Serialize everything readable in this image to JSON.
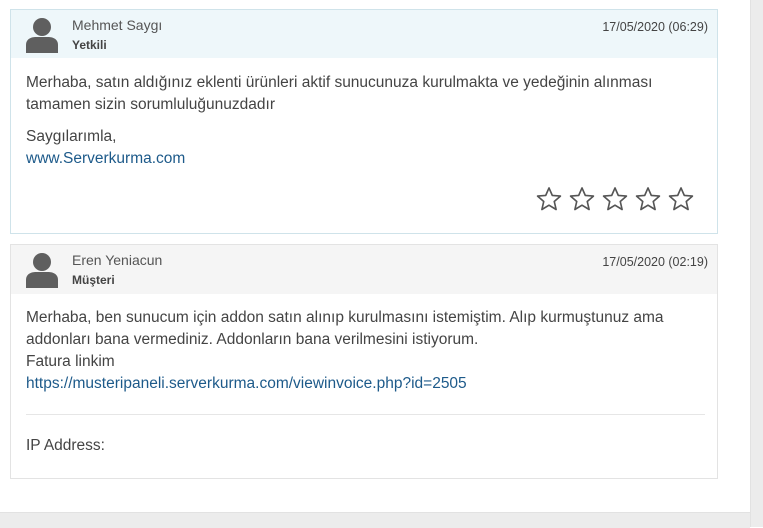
{
  "replies": [
    {
      "author": "Mehmet Saygı",
      "role": "Yetkili",
      "date": "17/05/2020 (06:29)",
      "message_line1": "Merhaba, satın aldığınız eklenti ürünleri aktif sunucunuza kurulmakta ve yedeğinin alınması tamamen sizin sorumluluğunuzdadır",
      "signature": "Saygılarımla,",
      "signature_link": "www.Serverkurma.com",
      "rating_stars": 5,
      "rating_value": 0
    },
    {
      "author": "Eren Yeniacun",
      "role": "Müşteri",
      "date": "17/05/2020 (02:19)",
      "message_line1": "Merhaba, ben sunucum için addon satın alınıp kurulmasını istemiştim. Alıp kurmuştunuz ama addonları bana vermediniz. Addonların bana verilmesini istiyorum.",
      "message_line2": "Fatura linkim",
      "invoice_link": "https://musteripaneli.serverkurma.com/viewinvoice.php?id=2505",
      "ip_label": "IP Address:",
      "ip_value": ""
    }
  ],
  "icons": {
    "avatar": "user-avatar-icon",
    "star": "star-outline-icon"
  },
  "colors": {
    "staff_header_bg": "#eef7fa",
    "client_header_bg": "#f5f5f5",
    "link": "#1d5a8a"
  }
}
